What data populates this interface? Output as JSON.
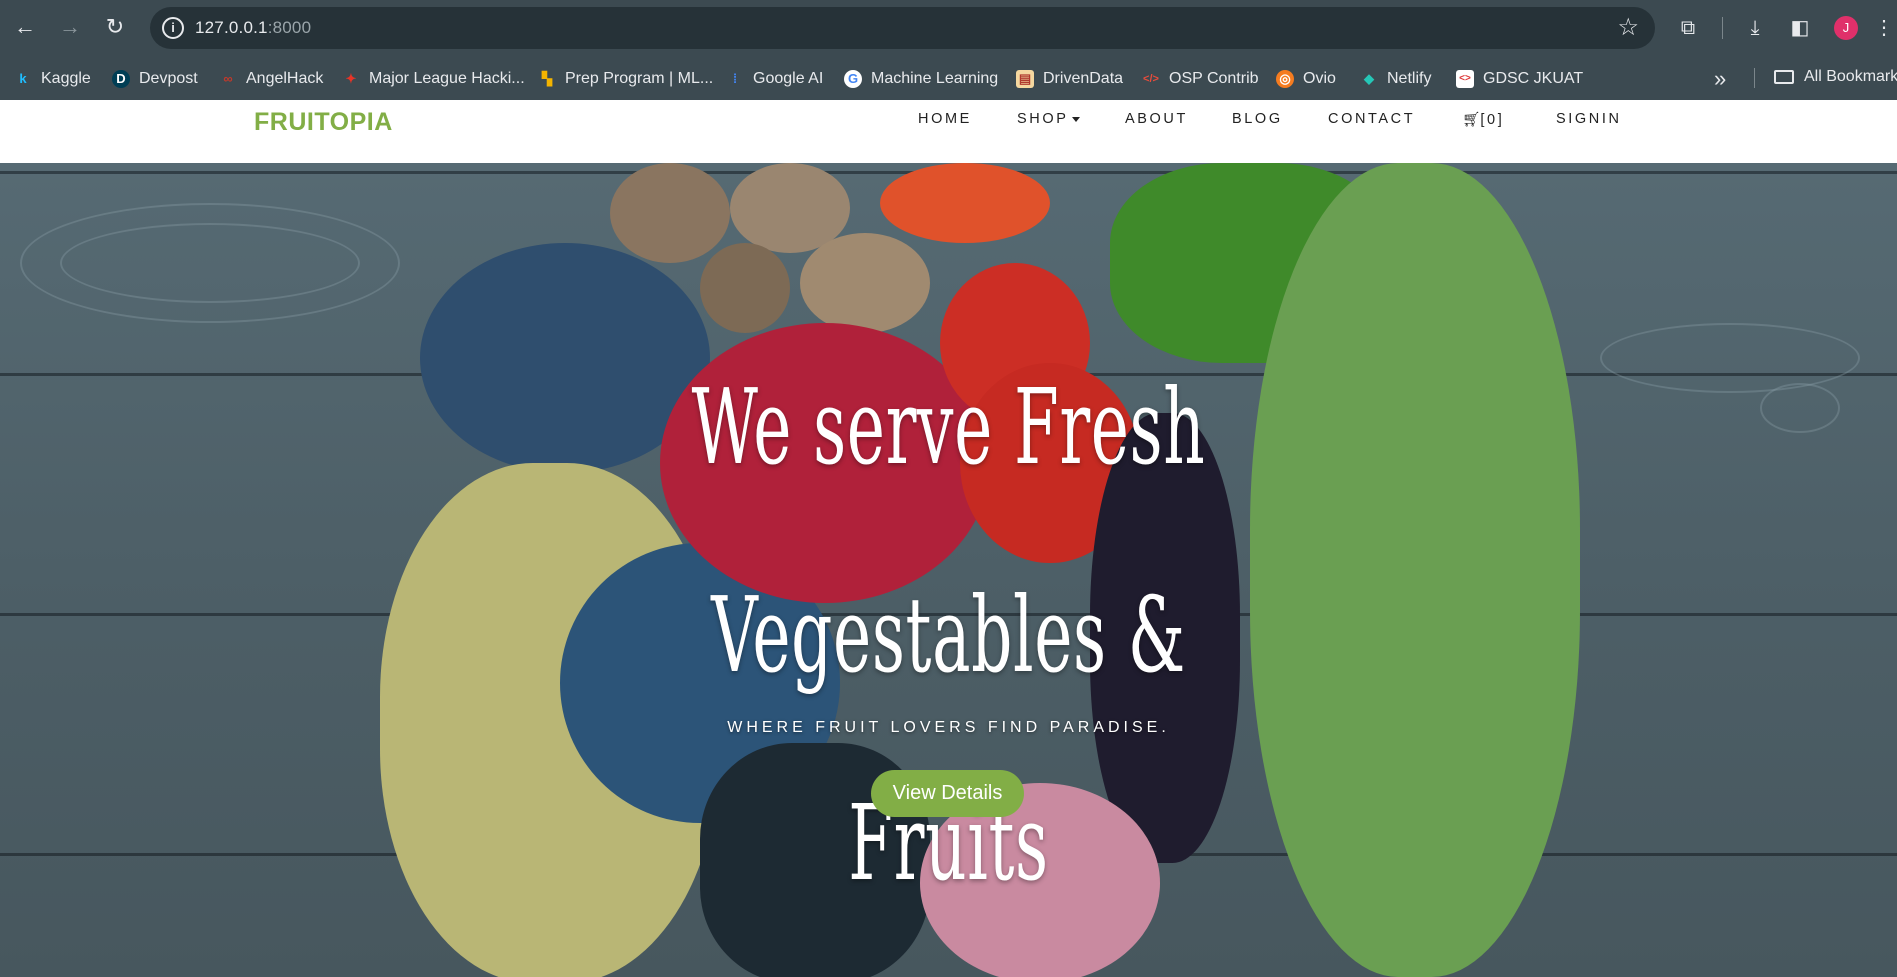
{
  "browser": {
    "url_host": "127.0.0.1",
    "url_port": ":8000",
    "avatar_initial": "J",
    "bookmarks": [
      {
        "label": "Kaggle",
        "icon": "kaggle-icon",
        "color": "#20beff",
        "glyph": "k"
      },
      {
        "label": "Devpost",
        "icon": "devpost-icon",
        "color": "#003e54",
        "glyph": "D"
      },
      {
        "label": "AngelHack",
        "icon": "angelhack-icon",
        "color": "#c0392b",
        "glyph": "∞"
      },
      {
        "label": "Major League Hacki...",
        "icon": "mlh-icon",
        "color": "#e73427",
        "glyph": "✦"
      },
      {
        "label": "Prep Program | ML...",
        "icon": "prep-program-icon",
        "color": "#f4b400",
        "glyph": "▚"
      },
      {
        "label": "Google AI",
        "icon": "google-ai-icon",
        "color": "#4285f4",
        "glyph": "⁞"
      },
      {
        "label": "Machine Learning",
        "icon": "google-icon",
        "color": "#ffffff",
        "glyph": "G"
      },
      {
        "label": "DrivenData",
        "icon": "drivendata-icon",
        "color": "#f5d8a0",
        "glyph": "▤"
      },
      {
        "label": "OSP Contrib",
        "icon": "osp-contrib-icon",
        "color": "#e74c3c",
        "glyph": "</>"
      },
      {
        "label": "Ovio",
        "icon": "ovio-icon",
        "color": "#f57c20",
        "glyph": "◎"
      },
      {
        "label": "Netlify",
        "icon": "netlify-icon",
        "color": "#25c7b7",
        "glyph": "◆"
      },
      {
        "label": "GDSC JKUAT",
        "icon": "gdsc-icon",
        "color": "#ffffff",
        "glyph": "<>"
      }
    ],
    "all_bookmarks_label": "All Bookmarks"
  },
  "site": {
    "logo": "FRUITOPIA",
    "brand_color": "#82ae46",
    "nav": {
      "home": "HOME",
      "shop": "SHOP",
      "about": "ABOUT",
      "blog": "BLOG",
      "contact": "CONTACT",
      "cart": "[0]",
      "signin": "SIGNIN"
    }
  },
  "hero": {
    "title_line1": "We serve Fresh Vegestables &",
    "title_line2": "Fruits",
    "subtitle": "WHERE FRUIT LOVERS FIND PARADISE.",
    "cta_label": "View Details"
  }
}
